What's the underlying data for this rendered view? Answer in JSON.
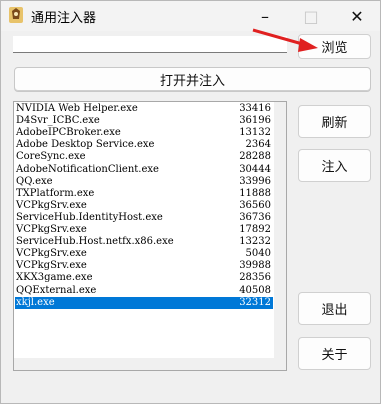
{
  "window": {
    "title": "通用注入器",
    "app_icon": "syringe-app-icon",
    "controls": {
      "minimize": "–",
      "maximize": "□",
      "close": "✕"
    }
  },
  "path_input": {
    "value": "",
    "placeholder": ""
  },
  "buttons": {
    "browse": "浏览",
    "open_and_inject": "打开并注入",
    "refresh": "刷新",
    "inject": "注入",
    "exit": "退出",
    "about": "关于"
  },
  "process_list": {
    "items": [
      {
        "name": "NVIDIA Web Helper.exe",
        "pid": "33416"
      },
      {
        "name": "D4Svr_ICBC.exe",
        "pid": "36196"
      },
      {
        "name": "AdobeIPCBroker.exe",
        "pid": "13132"
      },
      {
        "name": "Adobe Desktop Service.exe",
        "pid": "2364"
      },
      {
        "name": "CoreSync.exe",
        "pid": "28288"
      },
      {
        "name": "AdobeNotificationClient.exe",
        "pid": "30444"
      },
      {
        "name": "QQ.exe",
        "pid": "33996"
      },
      {
        "name": "TXPlatform.exe",
        "pid": "11888"
      },
      {
        "name": "VCPkgSrv.exe",
        "pid": "36560"
      },
      {
        "name": "ServiceHub.IdentityHost.exe",
        "pid": "36736"
      },
      {
        "name": "VCPkgSrv.exe",
        "pid": "17892"
      },
      {
        "name": "ServiceHub.Host.netfx.x86.exe",
        "pid": "13232"
      },
      {
        "name": "VCPkgSrv.exe",
        "pid": "5040"
      },
      {
        "name": "VCPkgSrv.exe",
        "pid": "39988"
      },
      {
        "name": "XKX3game.exe",
        "pid": "28356"
      },
      {
        "name": "QQExternal.exe",
        "pid": "40508"
      },
      {
        "name": "xkjl.exe",
        "pid": "32312"
      }
    ],
    "selected_index": 16
  },
  "colors": {
    "selection": "#0078d7",
    "arrow": "#e02020",
    "window_bg": "#f0f0f0"
  }
}
